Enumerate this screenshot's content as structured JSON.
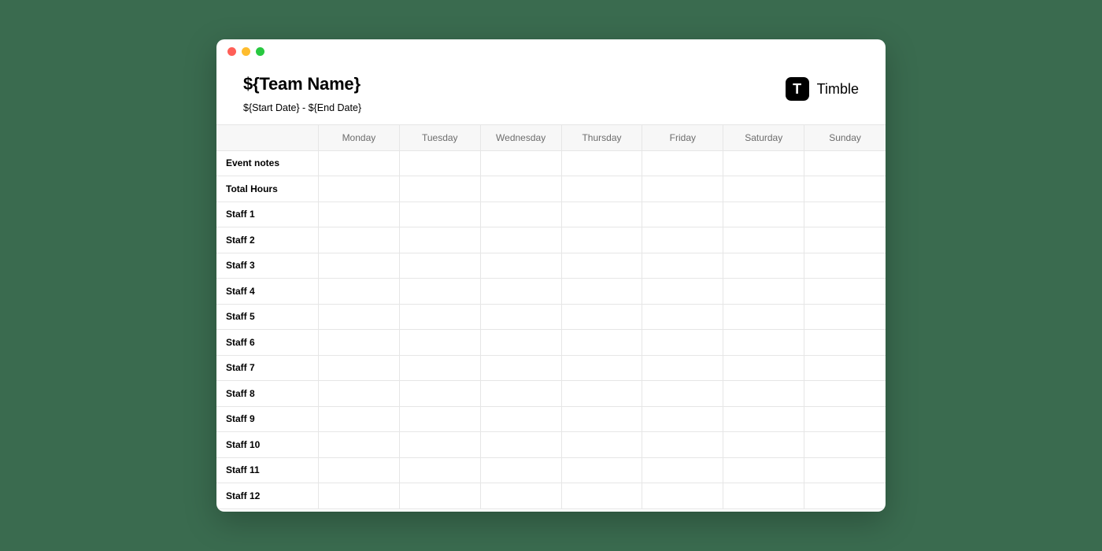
{
  "header": {
    "team_name": "${Team Name}",
    "date_range": "${Start Date} - ${End Date}"
  },
  "brand": {
    "logo_letter": "T",
    "name": "Timble"
  },
  "columns": [
    "Monday",
    "Tuesday",
    "Wednesday",
    "Thursday",
    "Friday",
    "Saturday",
    "Sunday"
  ],
  "rows": [
    "Event notes",
    "Total Hours",
    "Staff 1",
    "Staff 2",
    "Staff 3",
    "Staff 4",
    "Staff 5",
    "Staff 6",
    "Staff 7",
    "Staff 8",
    "Staff 9",
    "Staff 10",
    "Staff 11",
    "Staff 12"
  ]
}
